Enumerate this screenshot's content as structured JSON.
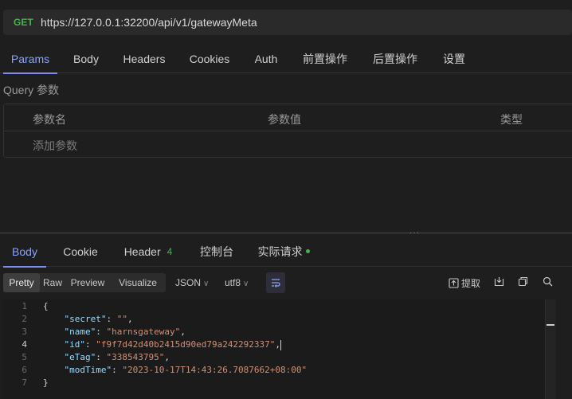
{
  "request": {
    "method": "GET",
    "url": "https://127.0.0.1:32200/api/v1/gatewayMeta"
  },
  "request_tabs": [
    {
      "label": "Params",
      "active": true
    },
    {
      "label": "Body",
      "active": false
    },
    {
      "label": "Headers",
      "active": false
    },
    {
      "label": "Cookies",
      "active": false
    },
    {
      "label": "Auth",
      "active": false
    },
    {
      "label": "前置操作",
      "active": false
    },
    {
      "label": "后置操作",
      "active": false
    },
    {
      "label": "设置",
      "active": false
    }
  ],
  "params": {
    "title": "Query 参数",
    "columns": [
      "参数名",
      "参数值",
      "类型"
    ],
    "add_placeholder": "添加参数"
  },
  "splitter_grip": "···",
  "response_tabs": [
    {
      "label": "Body",
      "active": true
    },
    {
      "label": "Cookie",
      "active": false
    },
    {
      "label": "Header",
      "badge": "4",
      "active": false
    },
    {
      "label": "控制台",
      "active": false
    },
    {
      "label": "实际请求",
      "active": false,
      "dot": true
    }
  ],
  "toolbar": {
    "formats": [
      "Pretty",
      "Raw",
      "Preview",
      "Visualize"
    ],
    "active_format": "Pretty",
    "type_select": "JSON",
    "encoding_select": "utf8",
    "extract_label": "提取",
    "icons": [
      "wrap-lines-icon",
      "extract-icon",
      "download-icon",
      "copy-icon",
      "search-icon"
    ]
  },
  "response_body": {
    "current_line": 4,
    "lines": [
      "{",
      "    \"secret\": \"\",",
      "    \"name\": \"harnsgateway\",",
      "    \"id\": \"f9f7d42d40b2415d90ed79a242292337\",",
      "    \"eTag\": \"338543795\",",
      "    \"modTime\": \"2023-10-17T14:43:26.7087662+08:00\"",
      "}"
    ]
  },
  "colors": {
    "accent": "#7b8ef0",
    "method_get": "#4caf50",
    "json_key": "#9cdcfe",
    "json_string": "#ce9178",
    "background": "#1e1e1e"
  }
}
